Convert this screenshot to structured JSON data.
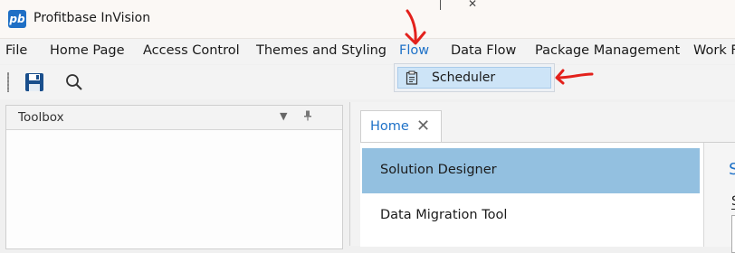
{
  "app": {
    "logo_text": "pb",
    "title": "Profitbase InVision"
  },
  "menu": {
    "items": [
      {
        "key": "file",
        "label": "File"
      },
      {
        "key": "home-page",
        "label": "Home Page"
      },
      {
        "key": "access-control",
        "label": "Access Control"
      },
      {
        "key": "themes-and-styling",
        "label": "Themes and Styling"
      },
      {
        "key": "flow",
        "label": "Flow"
      },
      {
        "key": "data-flow",
        "label": "Data Flow"
      },
      {
        "key": "package-management",
        "label": "Package Management"
      },
      {
        "key": "work-partial",
        "label": "Work F"
      }
    ],
    "active": "Flow",
    "dropdown": {
      "items": [
        {
          "label": "Scheduler",
          "icon": "clipboard-icon"
        }
      ]
    }
  },
  "toolbar": {
    "buttons": [
      {
        "icon": "save-icon"
      },
      {
        "icon": "search-icon"
      }
    ]
  },
  "toolbox": {
    "title": "Toolbox",
    "controls": [
      "chevron-down-icon",
      "pin-icon"
    ]
  },
  "document": {
    "tab": {
      "label": "Home",
      "close": "✕"
    },
    "list": [
      {
        "label": "Solution Designer",
        "selected": true
      },
      {
        "label": "Data Migration Tool",
        "selected": false
      }
    ],
    "right_panel": {
      "heading_partial": "S",
      "tab_partial": "S"
    }
  },
  "colors": {
    "accent": "#1f72c8",
    "selected_row": "#93c0e0",
    "annotation": "#e3211c"
  }
}
